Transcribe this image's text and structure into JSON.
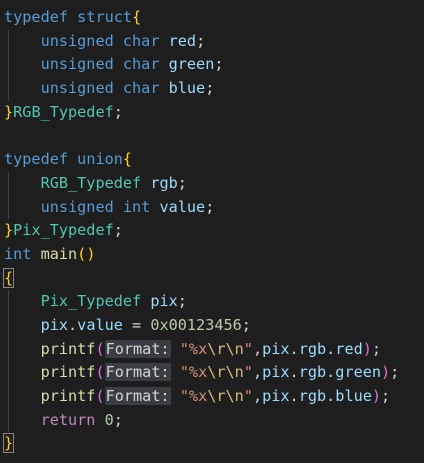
{
  "editor": {
    "lines": [
      [
        {
          "t": "typedef",
          "c": "kw"
        },
        {
          "t": " "
        },
        {
          "t": "struct",
          "c": "kw"
        },
        {
          "t": "{",
          "c": "br1"
        }
      ],
      [
        {
          "t": "    "
        },
        {
          "t": "unsigned",
          "c": "kw"
        },
        {
          "t": " "
        },
        {
          "t": "char",
          "c": "kw"
        },
        {
          "t": " "
        },
        {
          "t": "red",
          "c": "var"
        },
        {
          "t": ";"
        }
      ],
      [
        {
          "t": "    "
        },
        {
          "t": "unsigned",
          "c": "kw"
        },
        {
          "t": " "
        },
        {
          "t": "char",
          "c": "kw"
        },
        {
          "t": " "
        },
        {
          "t": "green",
          "c": "var"
        },
        {
          "t": ";"
        }
      ],
      [
        {
          "t": "    "
        },
        {
          "t": "unsigned",
          "c": "kw"
        },
        {
          "t": " "
        },
        {
          "t": "char",
          "c": "kw"
        },
        {
          "t": " "
        },
        {
          "t": "blue",
          "c": "var"
        },
        {
          "t": ";"
        }
      ],
      [
        {
          "t": "}",
          "c": "br1"
        },
        {
          "t": "RGB_Typedef",
          "c": "type"
        },
        {
          "t": ";"
        }
      ],
      [],
      [
        {
          "t": "typedef",
          "c": "kw"
        },
        {
          "t": " "
        },
        {
          "t": "union",
          "c": "kw"
        },
        {
          "t": "{",
          "c": "br1"
        }
      ],
      [
        {
          "t": "    "
        },
        {
          "t": "RGB_Typedef",
          "c": "type"
        },
        {
          "t": " "
        },
        {
          "t": "rgb",
          "c": "var"
        },
        {
          "t": ";"
        }
      ],
      [
        {
          "t": "    "
        },
        {
          "t": "unsigned",
          "c": "kw"
        },
        {
          "t": " "
        },
        {
          "t": "int",
          "c": "kw"
        },
        {
          "t": " "
        },
        {
          "t": "value",
          "c": "var"
        },
        {
          "t": ";"
        }
      ],
      [
        {
          "t": "}",
          "c": "br1"
        },
        {
          "t": "Pix_Typedef",
          "c": "type"
        },
        {
          "t": ";"
        }
      ],
      [
        {
          "t": "int",
          "c": "kw"
        },
        {
          "t": " "
        },
        {
          "t": "main",
          "c": "fn"
        },
        {
          "t": "()",
          "c": "br1"
        }
      ],
      [
        {
          "t": "{",
          "c": "br1 bracket-box"
        }
      ],
      [
        {
          "t": "    "
        },
        {
          "t": "Pix_Typedef",
          "c": "type"
        },
        {
          "t": " "
        },
        {
          "t": "pix",
          "c": "var"
        },
        {
          "t": ";"
        }
      ],
      [
        {
          "t": "    "
        },
        {
          "t": "pix",
          "c": "var"
        },
        {
          "t": "."
        },
        {
          "t": "value",
          "c": "var"
        },
        {
          "t": " = "
        },
        {
          "t": "0x00123456",
          "c": "num"
        },
        {
          "t": ";"
        }
      ],
      [
        {
          "t": "    "
        },
        {
          "t": "printf",
          "c": "fn"
        },
        {
          "t": "(",
          "c": "br2"
        },
        {
          "t": "Format:",
          "c": "hint"
        },
        {
          "t": " "
        },
        {
          "t": "\"%x",
          "c": "str"
        },
        {
          "t": "\\r\\n",
          "c": "esc"
        },
        {
          "t": "\"",
          "c": "str"
        },
        {
          "t": ","
        },
        {
          "t": "pix",
          "c": "var"
        },
        {
          "t": "."
        },
        {
          "t": "rgb",
          "c": "var"
        },
        {
          "t": "."
        },
        {
          "t": "red",
          "c": "var"
        },
        {
          "t": ")",
          "c": "br2"
        },
        {
          "t": ";"
        }
      ],
      [
        {
          "t": "    "
        },
        {
          "t": "printf",
          "c": "fn"
        },
        {
          "t": "(",
          "c": "br2"
        },
        {
          "t": "Format:",
          "c": "hint"
        },
        {
          "t": " "
        },
        {
          "t": "\"%x",
          "c": "str"
        },
        {
          "t": "\\r\\n",
          "c": "esc"
        },
        {
          "t": "\"",
          "c": "str"
        },
        {
          "t": ","
        },
        {
          "t": "pix",
          "c": "var"
        },
        {
          "t": "."
        },
        {
          "t": "rgb",
          "c": "var"
        },
        {
          "t": "."
        },
        {
          "t": "green",
          "c": "var"
        },
        {
          "t": ")",
          "c": "br2"
        },
        {
          "t": ";"
        }
      ],
      [
        {
          "t": "    "
        },
        {
          "t": "printf",
          "c": "fn"
        },
        {
          "t": "(",
          "c": "br2"
        },
        {
          "t": "Format:",
          "c": "hint"
        },
        {
          "t": " "
        },
        {
          "t": "\"%x",
          "c": "str"
        },
        {
          "t": "\\r\\n",
          "c": "esc"
        },
        {
          "t": "\"",
          "c": "str"
        },
        {
          "t": ","
        },
        {
          "t": "pix",
          "c": "var"
        },
        {
          "t": "."
        },
        {
          "t": "rgb",
          "c": "var"
        },
        {
          "t": "."
        },
        {
          "t": "blue",
          "c": "var"
        },
        {
          "t": ")",
          "c": "br2"
        },
        {
          "t": ";"
        }
      ],
      [
        {
          "t": "    "
        },
        {
          "t": "return",
          "c": "ctl"
        },
        {
          "t": " "
        },
        {
          "t": "0",
          "c": "num"
        },
        {
          "t": ";"
        }
      ],
      [
        {
          "t": "}",
          "c": "br1 bracket-box"
        }
      ]
    ]
  },
  "colors": {
    "background": "#1e1e1e",
    "keyword": "#569cd6",
    "control_keyword": "#c586c0",
    "type": "#4ec9b0",
    "function": "#dcdcaa",
    "variable": "#9cdcfe",
    "number": "#b5cea8",
    "string": "#ce9178",
    "bracket_level1": "#ffd700",
    "bracket_level2": "#da70d6",
    "inlay_hint_bg": "#3a3d41"
  }
}
